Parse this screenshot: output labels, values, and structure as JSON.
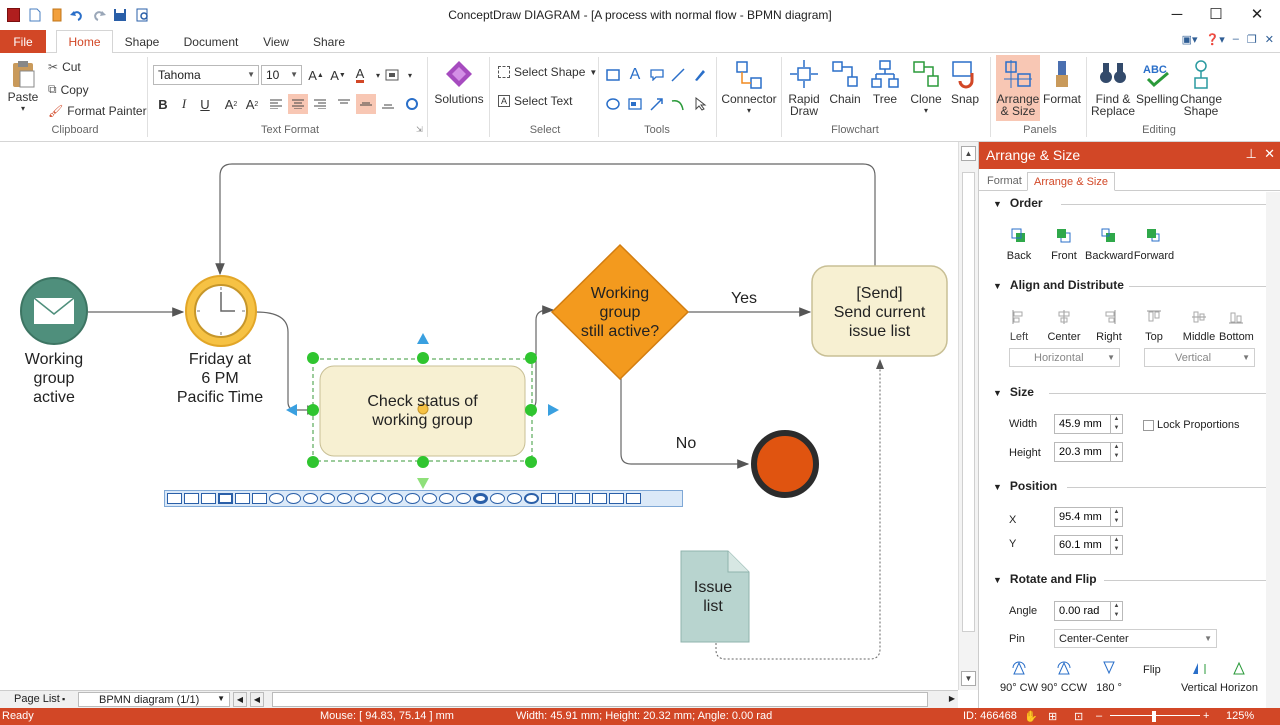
{
  "window": {
    "title": "ConceptDraw DIAGRAM - [A process with normal flow - BPMN diagram]",
    "min": "─",
    "max": "☐",
    "close": "✕"
  },
  "tabs": [
    {
      "label": "File"
    },
    {
      "label": "Home"
    },
    {
      "label": "Shape"
    },
    {
      "label": "Document"
    },
    {
      "label": "View"
    },
    {
      "label": "Share"
    }
  ],
  "ribbon": {
    "clipboard": {
      "paste": "Paste",
      "cut": "Cut",
      "copy": "Copy",
      "format_painter": "Format Painter",
      "group": "Clipboard"
    },
    "text_format": {
      "font": "Tahoma",
      "size": "10",
      "group": "Text Format"
    },
    "solutions": {
      "label": "Solutions"
    },
    "select": {
      "select_shape": "Select Shape",
      "select_text": "Select Text",
      "group": "Select"
    },
    "tools": {
      "group": "Tools"
    },
    "connector": {
      "label": "Connector"
    },
    "flowchart": {
      "rapid_draw_1": "Rapid",
      "rapid_draw_2": "Draw",
      "chain": "Chain",
      "tree": "Tree",
      "clone": "Clone",
      "snap": "Snap",
      "group": "Flowchart"
    },
    "panels": {
      "arrange_1": "Arrange",
      "arrange_2": "& Size",
      "format": "Format",
      "group": "Panels"
    },
    "editing": {
      "find_1": "Find &",
      "find_2": "Replace",
      "spelling": "Spelling",
      "change_1": "Change",
      "change_2": "Shape",
      "group": "Editing"
    }
  },
  "diagram": {
    "start_label": [
      "Working",
      "group",
      "active"
    ],
    "timer_label": [
      "Friday at",
      "6 PM",
      "Pacific Time"
    ],
    "task_label": [
      "Check status of",
      "working group"
    ],
    "gateway_label": [
      "Working",
      "group",
      "still active?"
    ],
    "send_label": [
      "[Send]",
      "Send current",
      "issue list"
    ],
    "yes": "Yes",
    "no": "No",
    "issue_label": [
      "Issue",
      "list"
    ]
  },
  "panel": {
    "title": "Arrange & Size",
    "tabs": [
      "Format",
      "Arrange & Size"
    ],
    "order": {
      "title": "Order",
      "buttons": [
        "Back",
        "Front",
        "Backward",
        "Forward"
      ]
    },
    "align": {
      "title": "Align and Distribute",
      "buttons": [
        "Left",
        "Center",
        "Right",
        "Top",
        "Middle",
        "Bottom"
      ],
      "horizontal": "Horizontal",
      "vertical": "Vertical"
    },
    "size": {
      "title": "Size",
      "width_label": "Width",
      "width": "45.9 mm",
      "height_label": "Height",
      "height": "20.3 mm",
      "lock": "Lock Proportions"
    },
    "position": {
      "title": "Position",
      "x_label": "X",
      "x": "95.4 mm",
      "y_label": "Y",
      "y": "60.1 mm"
    },
    "rotate": {
      "title": "Rotate and Flip",
      "angle_label": "Angle",
      "angle": "0.00 rad",
      "pin_label": "Pin",
      "pin": "Center-Center",
      "buttons": [
        "90° CW",
        "90° CCW",
        "180 °",
        "Flip",
        "Vertical",
        "Horizon"
      ]
    }
  },
  "pagebar": {
    "page_list": "Page List",
    "page": "BPMN diagram (1/1)"
  },
  "status": {
    "ready": "Ready",
    "mouse": "Mouse: [ 94.83, 75.14 ] mm",
    "dims": "Width: 45.91 mm;  Height: 20.32 mm;  Angle: 0.00 rad",
    "id": "ID: 466468",
    "zoom": "125%"
  }
}
